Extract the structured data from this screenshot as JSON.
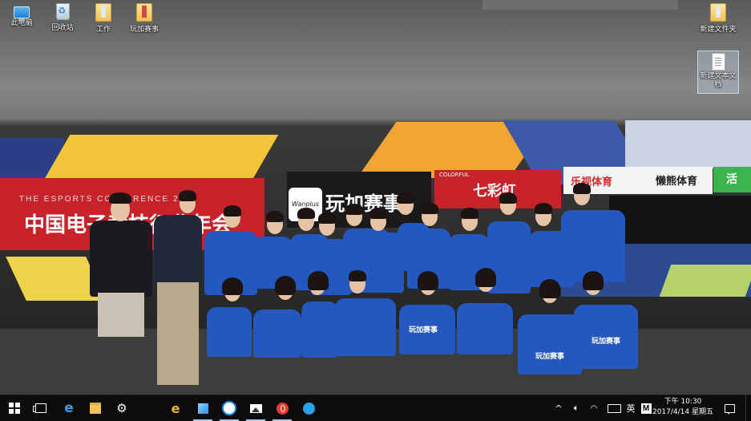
{
  "desktop": {
    "icons_left": [
      {
        "label": "此电脑",
        "icon": "this-pc-icon"
      },
      {
        "label": "回收站",
        "icon": "recycle-bin-icon"
      },
      {
        "label": "工作",
        "icon": "folder-icon"
      },
      {
        "label": "玩加赛事",
        "icon": "folder-icon"
      }
    ],
    "icons_right": [
      {
        "label": "新建文件夹",
        "icon": "folder-icon"
      },
      {
        "label": "新建文本文档",
        "icon": "text-document-icon"
      }
    ]
  },
  "wallpaper": {
    "banner_title": "THE ESPORTS CONFERENCE 2016",
    "banner_cn": "中国电子竞技行业年会",
    "logo_badge": "Wanplus",
    "logo_text": "玩加赛事",
    "sponsor_red_small": "COLORFUL",
    "sponsor_red": "七彩虹",
    "sponsor_le": "乐视体育",
    "sponsor_lan": "懒熊体育",
    "sponsor_green": "活",
    "shirt_logo": "玩加赛事"
  },
  "taskbar": {
    "pinned": [
      {
        "name": "start-button",
        "icon": "windows-logo-icon",
        "running": false
      },
      {
        "name": "task-view-button",
        "icon": "task-view-icon",
        "running": false
      },
      {
        "name": "edge-button",
        "icon": "edge-icon",
        "running": false
      },
      {
        "name": "file-explorer-button",
        "icon": "folder-icon",
        "running": false
      },
      {
        "name": "settings-button",
        "icon": "gear-icon",
        "running": false
      },
      {
        "name": "ie-button",
        "icon": "ie-icon",
        "running": false
      },
      {
        "name": "app-tile-button",
        "icon": "tile-app-icon",
        "running": true
      },
      {
        "name": "cloud-app-button",
        "icon": "cloud-icon",
        "running": true
      },
      {
        "name": "photos-button",
        "icon": "photos-icon",
        "running": true
      },
      {
        "name": "music-button",
        "icon": "netease-music-icon",
        "running": true
      },
      {
        "name": "user-app-button",
        "icon": "user-icon",
        "running": false
      }
    ],
    "tray": {
      "ime_lang": "英",
      "ime_mode": "M"
    },
    "clock": {
      "time": "下午 10:30",
      "date": "2017/4/14 星期五"
    }
  }
}
